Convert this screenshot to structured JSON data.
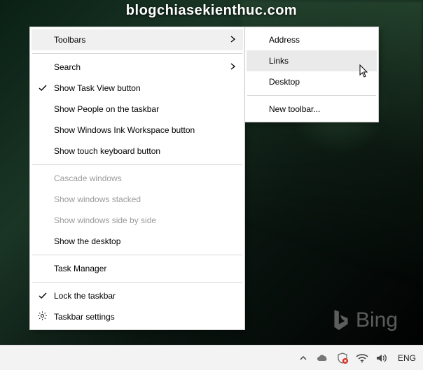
{
  "watermark": "blogchiasekienthuc.com",
  "bing_label": "Bing",
  "main_menu": {
    "toolbars": "Toolbars",
    "search": "Search",
    "show_task_view": "Show Task View button",
    "show_people": "Show People on the taskbar",
    "show_ink": "Show Windows Ink Workspace button",
    "show_touch_kb": "Show touch keyboard button",
    "cascade": "Cascade windows",
    "stacked": "Show windows stacked",
    "side_by_side": "Show windows side by side",
    "show_desktop": "Show the desktop",
    "task_manager": "Task Manager",
    "lock_taskbar": "Lock the taskbar",
    "taskbar_settings": "Taskbar settings"
  },
  "sub_menu": {
    "address": "Address",
    "links": "Links",
    "desktop": "Desktop",
    "new_toolbar": "New toolbar..."
  },
  "tray": {
    "language": "ENG"
  }
}
